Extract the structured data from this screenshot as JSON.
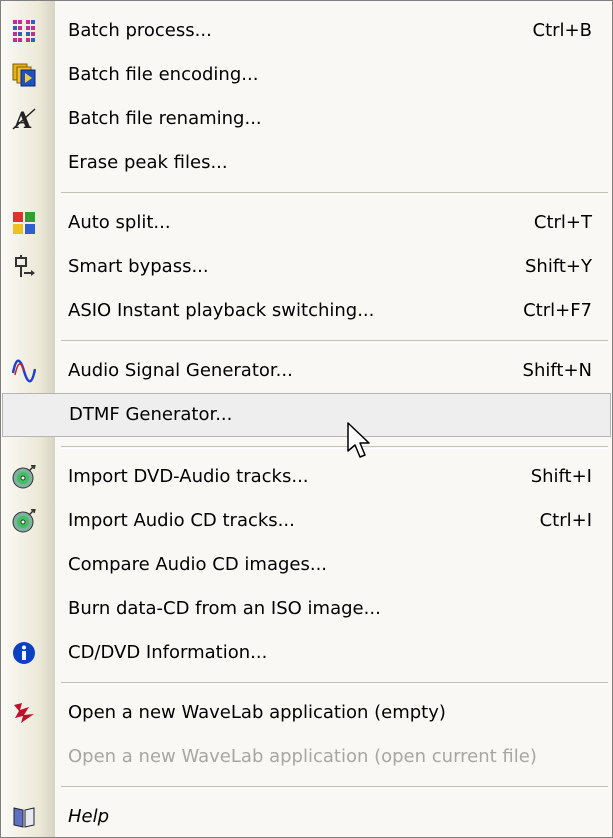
{
  "menu": {
    "items": [
      {
        "label": "Batch process...",
        "shortcut": "Ctrl+B",
        "icon": "batch-process-icon"
      },
      {
        "label": "Batch file encoding...",
        "shortcut": "",
        "icon": "batch-encoding-icon"
      },
      {
        "label": "Batch file renaming...",
        "shortcut": "",
        "icon": "batch-renaming-icon"
      },
      {
        "label": "Erase peak files...",
        "shortcut": ""
      },
      {
        "label": "Auto split...",
        "shortcut": "Ctrl+T",
        "icon": "auto-split-icon"
      },
      {
        "label": "Smart bypass...",
        "shortcut": "Shift+Y",
        "icon": "smart-bypass-icon"
      },
      {
        "label": "ASIO Instant playback switching...",
        "shortcut": "Ctrl+F7"
      },
      {
        "label": "Audio Signal Generator...",
        "shortcut": "Shift+N",
        "icon": "signal-wave-icon"
      },
      {
        "label": "DTMF Generator...",
        "shortcut": "",
        "state": "highlighted"
      },
      {
        "label": "Import DVD-Audio tracks...",
        "shortcut": "Shift+I",
        "icon": "disc-import-icon"
      },
      {
        "label": "Import Audio CD tracks...",
        "shortcut": "Ctrl+I",
        "icon": "disc-import-icon"
      },
      {
        "label": "Compare Audio CD images...",
        "shortcut": ""
      },
      {
        "label": "Burn data-CD from an ISO image...",
        "shortcut": ""
      },
      {
        "label": "CD/DVD Information...",
        "shortcut": "",
        "icon": "info-icon"
      },
      {
        "label": "Open a new WaveLab application (empty)",
        "shortcut": "",
        "icon": "wavelab-icon"
      },
      {
        "label": "Open a new WaveLab application (open current file)",
        "shortcut": "",
        "state": "disabled"
      },
      {
        "label": "Help",
        "shortcut": "",
        "icon": "help-book-icon"
      }
    ]
  },
  "colors": {
    "menu_background": "#f9f8f4",
    "gutter": "#ece9d8",
    "highlight_background": "#eeeeee",
    "highlight_border": "#b5b5b5",
    "disabled_text": "#a8a6a0",
    "info_blue": "#0b3fc4",
    "wavelab_red": "#c0102a"
  }
}
